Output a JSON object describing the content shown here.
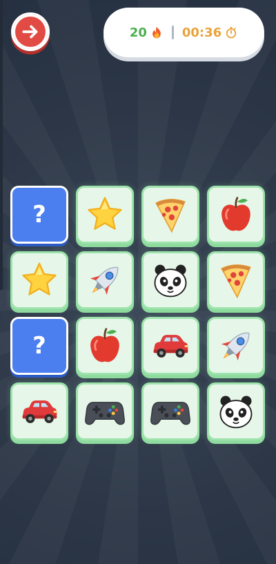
{
  "header": {
    "score_value": "20",
    "timer_value": "00:36",
    "colors": {
      "score": "#4caf50",
      "timer": "#e8a33a",
      "exit": "#e24a44"
    }
  },
  "board": {
    "hidden_label": "?",
    "cards": [
      {
        "state": "hidden",
        "icon": "unknown"
      },
      {
        "state": "revealed",
        "icon": "star-icon"
      },
      {
        "state": "revealed",
        "icon": "pizza-icon"
      },
      {
        "state": "revealed",
        "icon": "apple-icon"
      },
      {
        "state": "revealed",
        "icon": "star-icon"
      },
      {
        "state": "revealed",
        "icon": "rocket-icon"
      },
      {
        "state": "revealed",
        "icon": "panda-icon"
      },
      {
        "state": "revealed",
        "icon": "pizza-icon"
      },
      {
        "state": "hidden",
        "icon": "unknown"
      },
      {
        "state": "revealed",
        "icon": "apple-icon"
      },
      {
        "state": "revealed",
        "icon": "car-icon"
      },
      {
        "state": "revealed",
        "icon": "rocket-icon"
      },
      {
        "state": "revealed",
        "icon": "car-icon"
      },
      {
        "state": "revealed",
        "icon": "gamepad-icon"
      },
      {
        "state": "revealed",
        "icon": "gamepad-icon"
      },
      {
        "state": "revealed",
        "icon": "panda-icon"
      }
    ]
  }
}
